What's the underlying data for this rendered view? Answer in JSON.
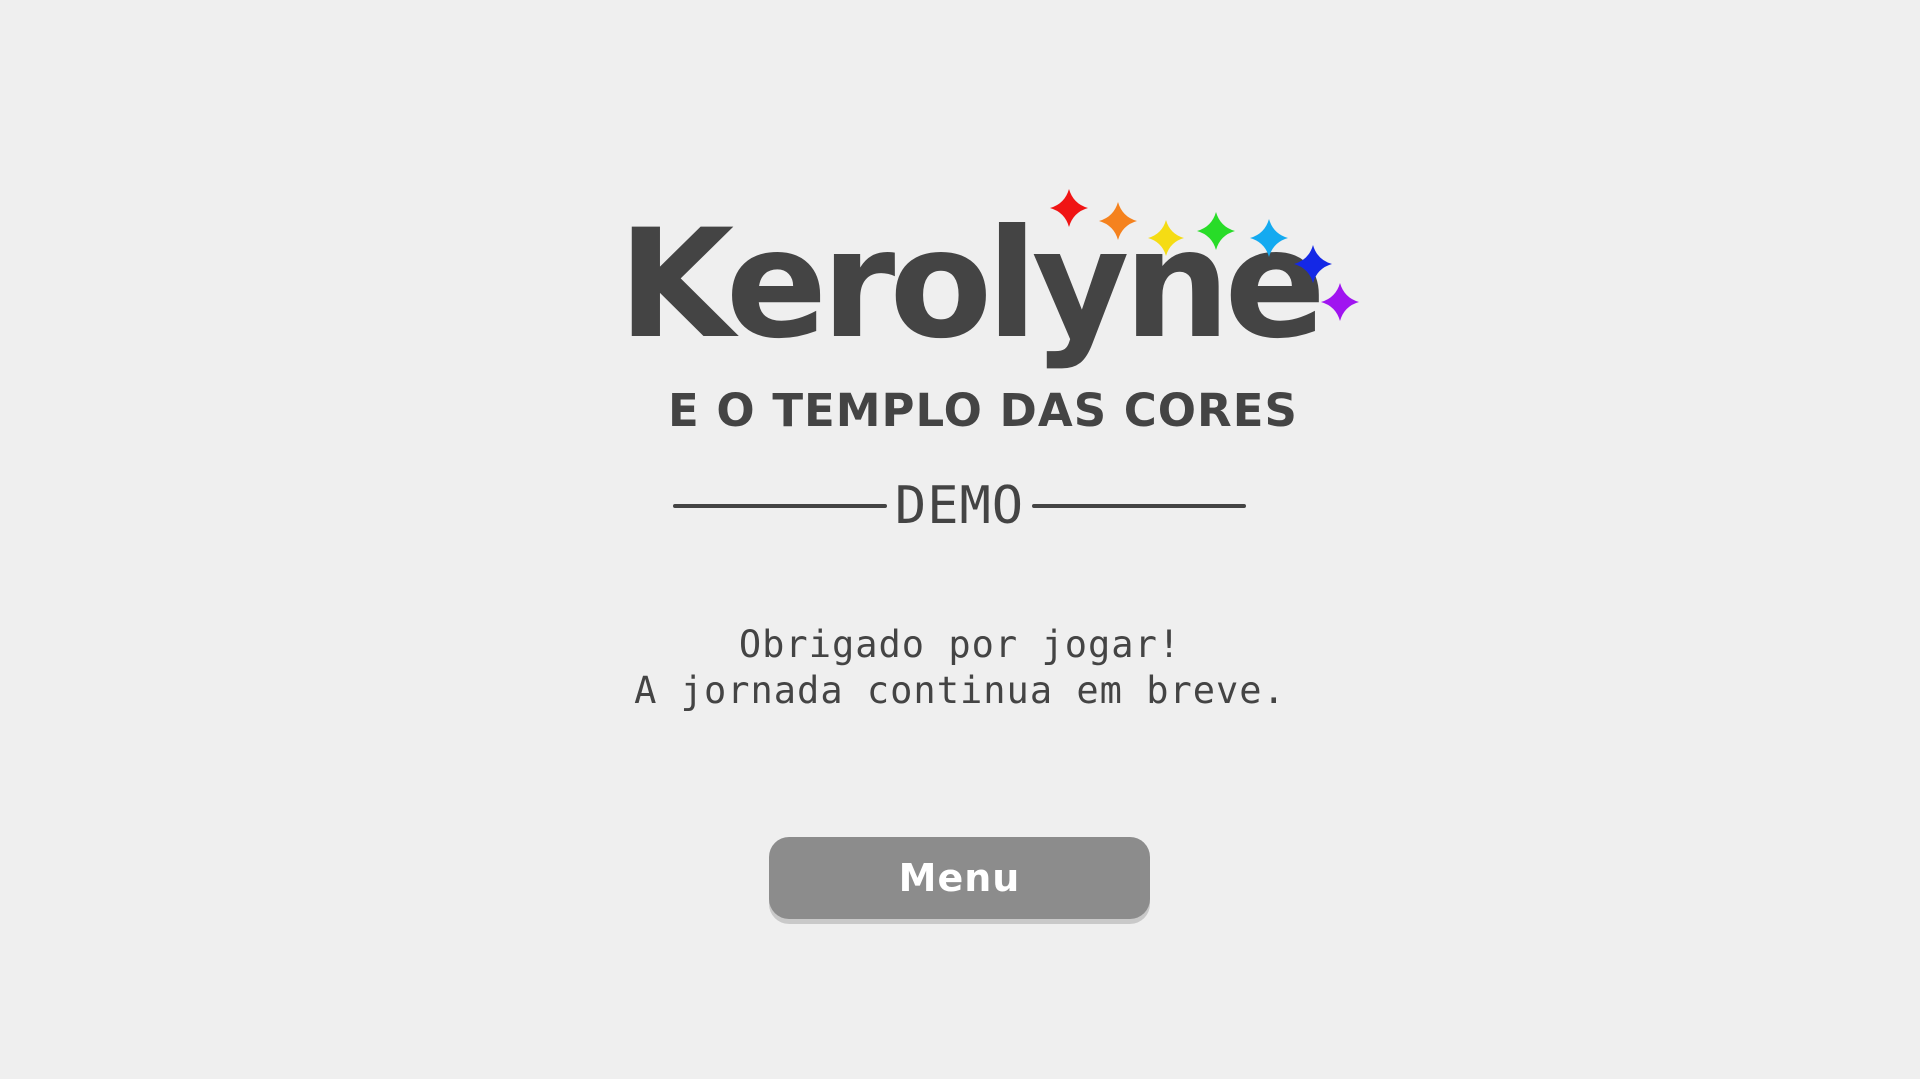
{
  "logo": {
    "title": "Kerolyne",
    "subtitle": "E O TEMPLO DAS CORES",
    "sparkle_colors": [
      "#f01414",
      "#f5821e",
      "#f5dc14",
      "#28dc28",
      "#14aaf0",
      "#1428e6",
      "#a014f0"
    ]
  },
  "demo_label": "DEMO",
  "message": {
    "line1": "Obrigado por jogar!",
    "line2": "A jornada continua em breve."
  },
  "menu_button": {
    "label": "Menu"
  },
  "colors": {
    "background": "#efefef",
    "text": "#444444",
    "button": "#8c8c8c"
  }
}
